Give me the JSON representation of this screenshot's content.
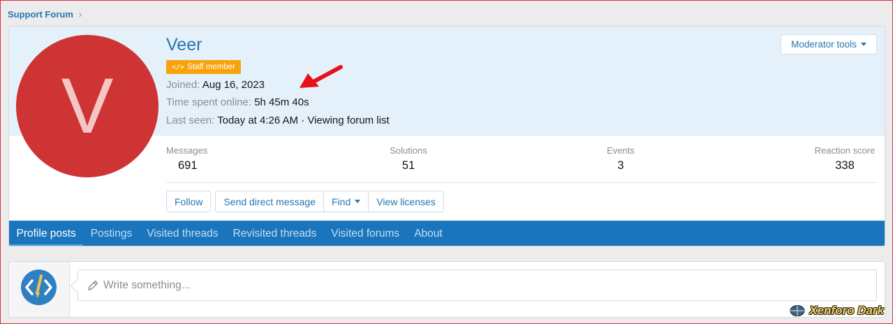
{
  "breadcrumb": {
    "label": "Support Forum",
    "chevron": "›"
  },
  "profile": {
    "avatar_letter": "V",
    "username": "Veer",
    "badge": {
      "icon": "</>",
      "label": "Staff member"
    },
    "joined": {
      "label": "Joined:",
      "value": "Aug 16, 2023"
    },
    "time_online": {
      "label": "Time spent online:",
      "value": "5h 45m 40s"
    },
    "last_seen": {
      "label": "Last seen:",
      "value": "Today at 4:26 AM · Viewing forum list"
    },
    "moderator_tools": "Moderator tools"
  },
  "stats": [
    {
      "label": "Messages",
      "value": "691"
    },
    {
      "label": "Solutions",
      "value": "51"
    },
    {
      "label": "Events",
      "value": "3"
    },
    {
      "label": "Reaction score",
      "value": "338"
    }
  ],
  "actions": {
    "follow": "Follow",
    "send_message": "Send direct message",
    "find": "Find",
    "view_licenses": "View licenses"
  },
  "tabs": [
    {
      "label": "Profile posts",
      "active": true
    },
    {
      "label": "Postings",
      "active": false
    },
    {
      "label": "Visited threads",
      "active": false
    },
    {
      "label": "Revisited threads",
      "active": false
    },
    {
      "label": "Visited forums",
      "active": false
    },
    {
      "label": "About",
      "active": false
    }
  ],
  "composer": {
    "placeholder": "Write something..."
  },
  "watermark": {
    "text": "Xenforo Dark"
  },
  "colors": {
    "accent": "#2577b1",
    "tab_bar": "#1a75bd",
    "avatar": "#cf3434",
    "badge": "#f7a30d",
    "annotation_arrow": "#e8101c"
  }
}
